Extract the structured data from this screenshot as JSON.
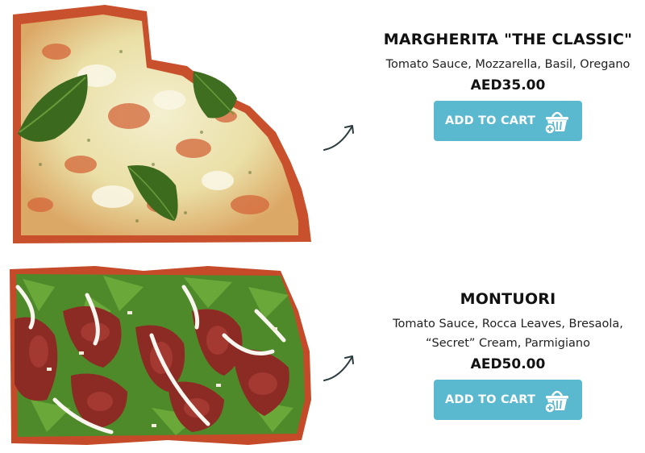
{
  "products": [
    {
      "name": "MARGHERITA \"THE CLASSIC\"",
      "description": "Tomato Sauce, Mozzarella, Basil, Oregano",
      "price": "AED35.00",
      "button_label": "ADD TO CART",
      "image_icon": "pizza-slice-photo",
      "cart_icon": "shopping-basket-add-icon"
    },
    {
      "name": "MONTUORI",
      "description_line1": "Tomato Sauce, Rocca Leaves, Bresaola,",
      "description_line2": "“Secret” Cream, Parmigiano",
      "price": "AED50.00",
      "button_label": "ADD TO CART",
      "image_icon": "pizza-slice-photo",
      "cart_icon": "shopping-basket-add-icon"
    }
  ],
  "colors": {
    "button_bg": "#5ab8cf",
    "button_text": "#ffffff",
    "arrow": "#2b3b3f"
  }
}
